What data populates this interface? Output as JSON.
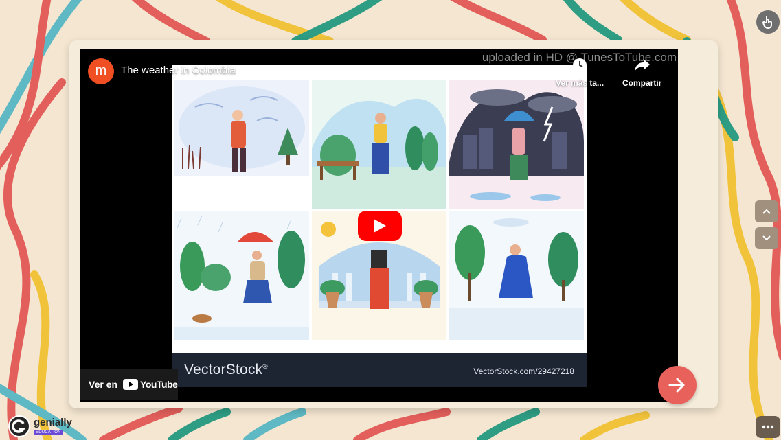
{
  "video": {
    "channel_initial": "m",
    "title": "The weather in Colombia",
    "watermark": "uploaded in HD @ TunesToTube.com",
    "watch_later_label": "Ver más ta...",
    "share_label": "Compartir",
    "watch_on_label": "Ver en",
    "youtube_label": "YouTube",
    "thumbnail": {
      "brand": "VectorStock",
      "brand_mark": "®",
      "url_text": "VectorStock.com/29427218",
      "scenes": [
        "windy-snow",
        "sunny-park",
        "storm-umbrella",
        "rain-dog-walk",
        "sunny-balcony",
        "windy-trees"
      ]
    }
  },
  "nav": {
    "next_icon": "arrow-right-icon",
    "up_icon": "chevron-up-icon",
    "down_icon": "chevron-down-icon",
    "top_icon": "hand-pointer-icon",
    "more_icon": "ellipsis-icon"
  },
  "brand": {
    "name": "genially",
    "badge": "EDUCATION"
  },
  "colors": {
    "accent_red": "#e8625b",
    "youtube_red": "#ff0000",
    "background_cream": "#f4e6d0"
  }
}
